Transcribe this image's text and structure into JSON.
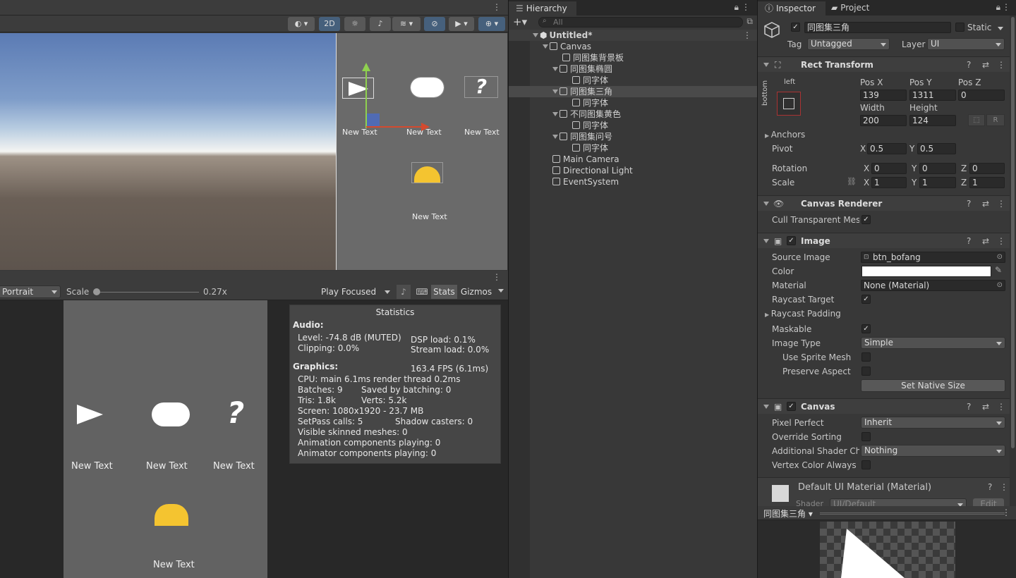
{
  "scene": {
    "btn_2d": "2D",
    "canvas_labels": [
      "New Text",
      "New Text",
      "New Text",
      "New Text"
    ]
  },
  "game": {
    "aspect": "Portrait",
    "scale_label": "Scale",
    "scale_value": "0.27x",
    "play_mode": "Play Focused",
    "stats_btn": "Stats",
    "gizmos_btn": "Gizmos",
    "labels": [
      "New Text",
      "New Text",
      "New Text",
      "New Text"
    ]
  },
  "stats": {
    "title": "Statistics",
    "audio": "Audio:",
    "level": "Level: -74.8 dB (MUTED)",
    "clipping": "Clipping: 0.0%",
    "dsp": "DSP load: 0.1%",
    "stream": "Stream load: 0.0%",
    "graphics": "Graphics:",
    "fps": "163.4 FPS (6.1ms)",
    "cpu": "CPU: main 6.1ms  render thread 0.2ms",
    "batches": "Batches: 9",
    "saved": "Saved by batching: 0",
    "tris": "Tris: 1.8k",
    "verts": "Verts: 5.2k",
    "screen": "Screen: 1080x1920 - 23.7 MB",
    "setpass": "SetPass calls: 5",
    "shadow": "Shadow casters: 0",
    "skinned": "Visible skinned meshes: 0",
    "anim": "Animation components playing: 0",
    "animator": "Animator components playing: 0"
  },
  "hierarchy": {
    "tab": "Hierarchy",
    "search_placeholder": "All",
    "items": [
      {
        "label": "Untitled*"
      },
      {
        "label": "Canvas"
      },
      {
        "label": "同图集背景板"
      },
      {
        "label": "同图集椭圆"
      },
      {
        "label": "同字体"
      },
      {
        "label": "同图集三角"
      },
      {
        "label": "同字体"
      },
      {
        "label": "不同图集黄色"
      },
      {
        "label": "同字体"
      },
      {
        "label": "同图集问号"
      },
      {
        "label": "同字体"
      },
      {
        "label": "Main Camera"
      },
      {
        "label": "Directional Light"
      },
      {
        "label": "EventSystem"
      }
    ]
  },
  "inspector": {
    "tab_inspector": "Inspector",
    "tab_project": "Project",
    "object_name": "同图集三角",
    "static": "Static",
    "tag_label": "Tag",
    "tag_value": "Untagged",
    "layer_label": "Layer",
    "layer_value": "UI",
    "rect": {
      "title": "Rect Transform",
      "anchor_left": "left",
      "anchor_bottom": "bottom",
      "posx_l": "Pos X",
      "posy_l": "Pos Y",
      "posz_l": "Pos Z",
      "posx": "139",
      "posy": "1311",
      "posz": "0",
      "width_l": "Width",
      "height_l": "Height",
      "width": "200",
      "height": "124",
      "r_btn": "R",
      "anchors": "Anchors",
      "pivot": "Pivot",
      "pivot_x": "0.5",
      "pivot_y": "0.5",
      "rotation": "Rotation",
      "rot_x": "0",
      "rot_y": "0",
      "rot_z": "0",
      "scale": "Scale",
      "sc_x": "1",
      "sc_y": "1",
      "sc_z": "1",
      "x": "X",
      "y": "Y",
      "z": "Z"
    },
    "canvas_renderer": {
      "title": "Canvas Renderer",
      "cull": "Cull Transparent Mesh"
    },
    "image": {
      "title": "Image",
      "source_l": "Source Image",
      "source": "btn_bofang",
      "color_l": "Color",
      "material_l": "Material",
      "material": "None (Material)",
      "raycast_target": "Raycast Target",
      "raycast_padding": "Raycast Padding",
      "maskable": "Maskable",
      "image_type_l": "Image Type",
      "image_type": "Simple",
      "use_sprite_mesh": "Use Sprite Mesh",
      "preserve_aspect": "Preserve Aspect",
      "set_native": "Set Native Size"
    },
    "canvas": {
      "title": "Canvas",
      "pixel_perfect_l": "Pixel Perfect",
      "pixel_perfect": "Inherit",
      "override_sorting": "Override Sorting",
      "shader_l": "Additional Shader Cha",
      "shader": "Nothing",
      "vertex": "Vertex Color Always In"
    },
    "material": {
      "title": "Default UI Material (Material)",
      "shader_l": "Shader",
      "shader": "UI/Default",
      "edit": "Edit"
    },
    "preview_label": "同图集三角"
  }
}
